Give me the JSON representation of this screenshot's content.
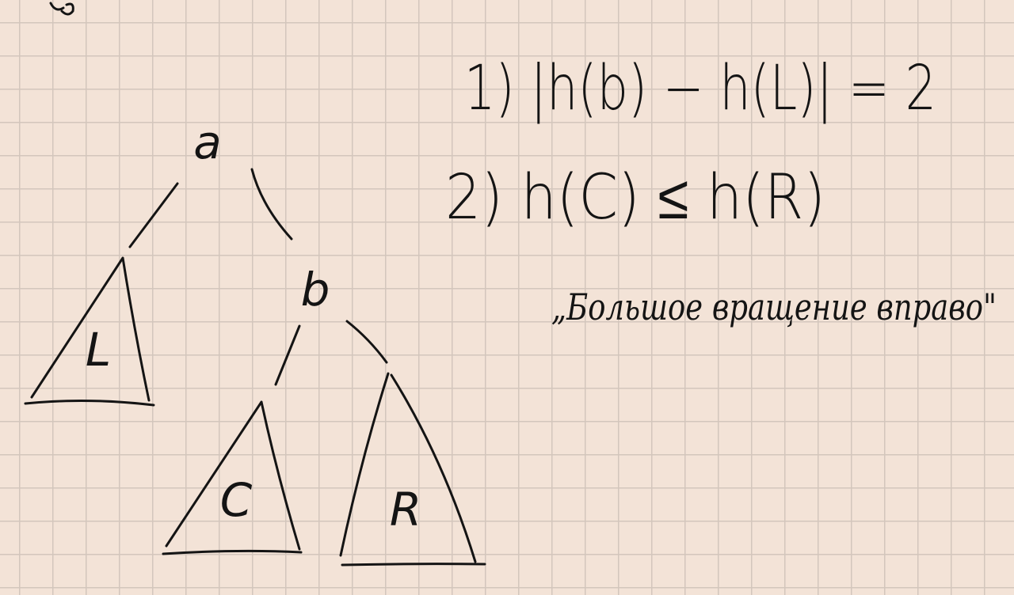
{
  "diagram": {
    "nodes": {
      "root": "a",
      "right_child": "b"
    },
    "subtrees": {
      "left": "L",
      "middle": "C",
      "right": "R"
    }
  },
  "conditions": {
    "first": "1) |h(b) − h(L)| = 2",
    "second": "2) h(C) ≤ h(R)"
  },
  "caption": "„Большое вращение вправо\"",
  "colors": {
    "paper": "#f3e3d7",
    "grid": "#d3c6bc",
    "ink": "#141414"
  }
}
